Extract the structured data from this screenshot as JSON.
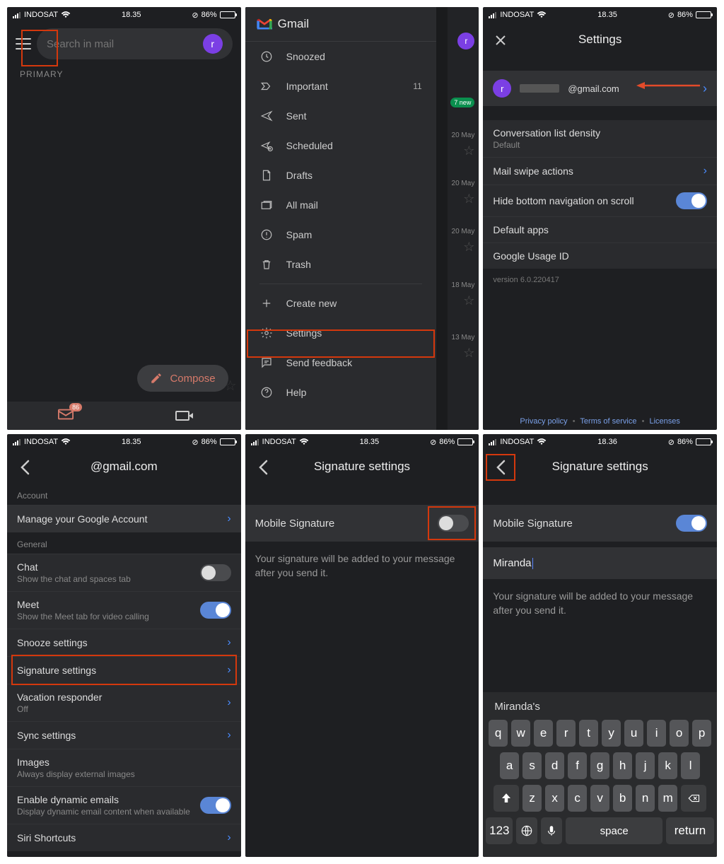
{
  "status": {
    "carrier": "INDOSAT",
    "time1": "18.35",
    "time2": "18.36",
    "battery_pct": "86%"
  },
  "s1": {
    "search_placeholder": "Search in mail",
    "avatar_letter": "r",
    "primary": "PRIMARY",
    "compose": "Compose",
    "mail_badge": "86"
  },
  "s2": {
    "app_name": "Gmail",
    "new_badge": "7 new",
    "items": {
      "snoozed": "Snoozed",
      "important": "Important",
      "important_count": "11",
      "sent": "Sent",
      "scheduled": "Scheduled",
      "drafts": "Drafts",
      "allmail": "All mail",
      "spam": "Spam",
      "trash": "Trash",
      "create": "Create new",
      "settings": "Settings",
      "feedback": "Send feedback",
      "help": "Help"
    },
    "peek_dates": {
      "d1": "20 May",
      "d2": "20 May",
      "d3": "20 May",
      "d4": "18 May",
      "d5": "13 May"
    }
  },
  "s3": {
    "title": "Settings",
    "avatar_letter": "r",
    "email_suffix": "@gmail.com",
    "rows": {
      "density": "Conversation list density",
      "density_sub": "Default",
      "swipe": "Mail swipe actions",
      "hidebottom": "Hide bottom navigation on scroll",
      "defaultapps": "Default apps",
      "usageid": "Google Usage ID"
    },
    "version": "version 6.0.220417",
    "footer": {
      "privacy": "Privacy policy",
      "terms": "Terms of service",
      "licenses": "Licenses"
    }
  },
  "s4": {
    "title_suffix": "@gmail.com",
    "section_account": "Account",
    "manage": "Manage your Google Account",
    "section_general": "General",
    "rows": {
      "chat": "Chat",
      "chat_sub": "Show the chat and spaces tab",
      "meet": "Meet",
      "meet_sub": "Show the Meet tab for video calling",
      "snooze": "Snooze settings",
      "signature": "Signature settings",
      "vacation": "Vacation responder",
      "vacation_sub": "Off",
      "sync": "Sync settings",
      "images": "Images",
      "images_sub": "Always display external images",
      "dynamic": "Enable dynamic emails",
      "dynamic_sub": "Display dynamic email content when available",
      "siri": "Siri Shortcuts"
    }
  },
  "s5": {
    "title": "Signature settings",
    "mobile_sig": "Mobile Signature",
    "desc": "Your signature will be added to your message after you send it."
  },
  "s6": {
    "title": "Signature settings",
    "mobile_sig": "Mobile Signature",
    "sig_value": "Miranda",
    "desc": "Your signature will be added to your message after you send it.",
    "suggestion": "Miranda's",
    "kb": {
      "r1": [
        "q",
        "w",
        "e",
        "r",
        "t",
        "y",
        "u",
        "i",
        "o",
        "p"
      ],
      "r2": [
        "a",
        "s",
        "d",
        "f",
        "g",
        "h",
        "j",
        "k",
        "l"
      ],
      "r3": [
        "z",
        "x",
        "c",
        "v",
        "b",
        "n",
        "m"
      ],
      "num": "123",
      "space": "space",
      "return": "return"
    }
  }
}
